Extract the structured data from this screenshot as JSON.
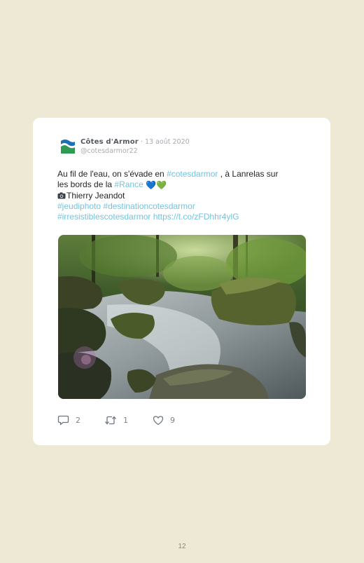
{
  "tweet": {
    "author": "Côtes d'Armor",
    "separator": " · ",
    "date": "13 août 2020",
    "handle": "@cotesdarmor22",
    "text": {
      "line1_start": "Au fil de l'eau, on s'évade en ",
      "hashtag_cotesdarmor": "#cotesdarmor",
      "line1_end": " , à Lanrelas sur",
      "line2_start": "les bords de la ",
      "hashtag_rance": "#Rance",
      "line2_hearts": "💙💚",
      "photo_credit": "Thierry Jeandot",
      "hashtag_jeudiphoto": "#jeudiphoto",
      "hashtag_destination": "#destinationcotesdarmor",
      "hashtag_irresistibles": "#irresistiblescotesdarmor",
      "link": "https://t.co/zFDhhr4ylG"
    },
    "icons": {
      "avatar": "cotes-darmor-logo-icon",
      "camera": "camera-icon",
      "reply": "reply-icon",
      "retweet": "retweet-icon",
      "like": "heart-icon"
    },
    "stats": {
      "replies": "2",
      "retweets": "1",
      "likes": "9"
    }
  },
  "colors": {
    "background": "#ede9d4",
    "card": "#ffffff",
    "link": "#74c2df",
    "logo_green": "#2e9a52",
    "logo_blue": "#1d6fb6"
  },
  "page": {
    "number": "12"
  }
}
